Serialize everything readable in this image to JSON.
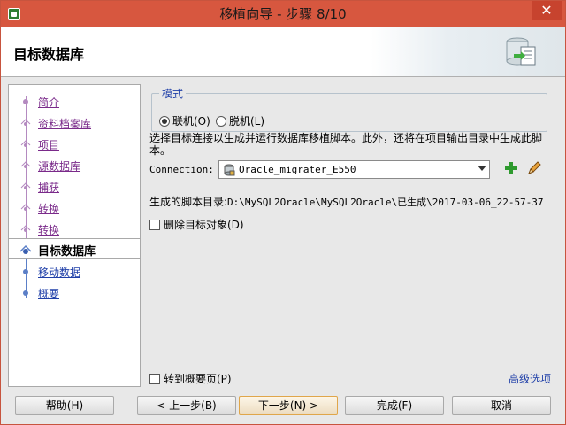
{
  "window": {
    "title": "移植向导 - 步骤 8/10",
    "close_glyph": "✕"
  },
  "header": {
    "title": "目标数据库"
  },
  "nav": {
    "items": [
      {
        "label": "简介",
        "state": "done"
      },
      {
        "label": "资料档案库",
        "state": "done"
      },
      {
        "label": "项目",
        "state": "done"
      },
      {
        "label": "源数据库",
        "state": "done"
      },
      {
        "label": "捕获",
        "state": "done"
      },
      {
        "label": "转换",
        "state": "done"
      },
      {
        "label": "转换",
        "state": "done"
      },
      {
        "label": "目标数据库",
        "state": "current"
      },
      {
        "label": "移动数据",
        "state": "upcoming"
      },
      {
        "label": "概要",
        "state": "upcoming"
      }
    ]
  },
  "main": {
    "mode_group": {
      "legend": "模式",
      "online_label": "联机(O)",
      "offline_label": "脱机(L)",
      "selected": "online"
    },
    "description": "选择目标连接以生成并运行数据库移植脚本。此外，还将在项目输出目录中生成此脚本。",
    "connection_label": "Connection:",
    "connection_value": "Oracle_migrater_E550",
    "script_dir_label": "生成的脚本目录:",
    "script_dir_path": "D:\\MySQL2Oracle\\MySQL2Oracle\\已生成\\2017-03-06_22-57-37",
    "delete_target_label": "删除目标对象(D)",
    "goto_overview_label": "转到概要页(P)",
    "advanced_link": "高级选项"
  },
  "buttons": {
    "help": "帮助(H)",
    "back": "< 上一步(B)",
    "next": "下一步(N) >",
    "finish": "完成(F)",
    "cancel": "取消"
  },
  "colors": {
    "titlebar": "#d7573f",
    "visited_link": "#7a2a8a",
    "link": "#1f3fa8"
  }
}
